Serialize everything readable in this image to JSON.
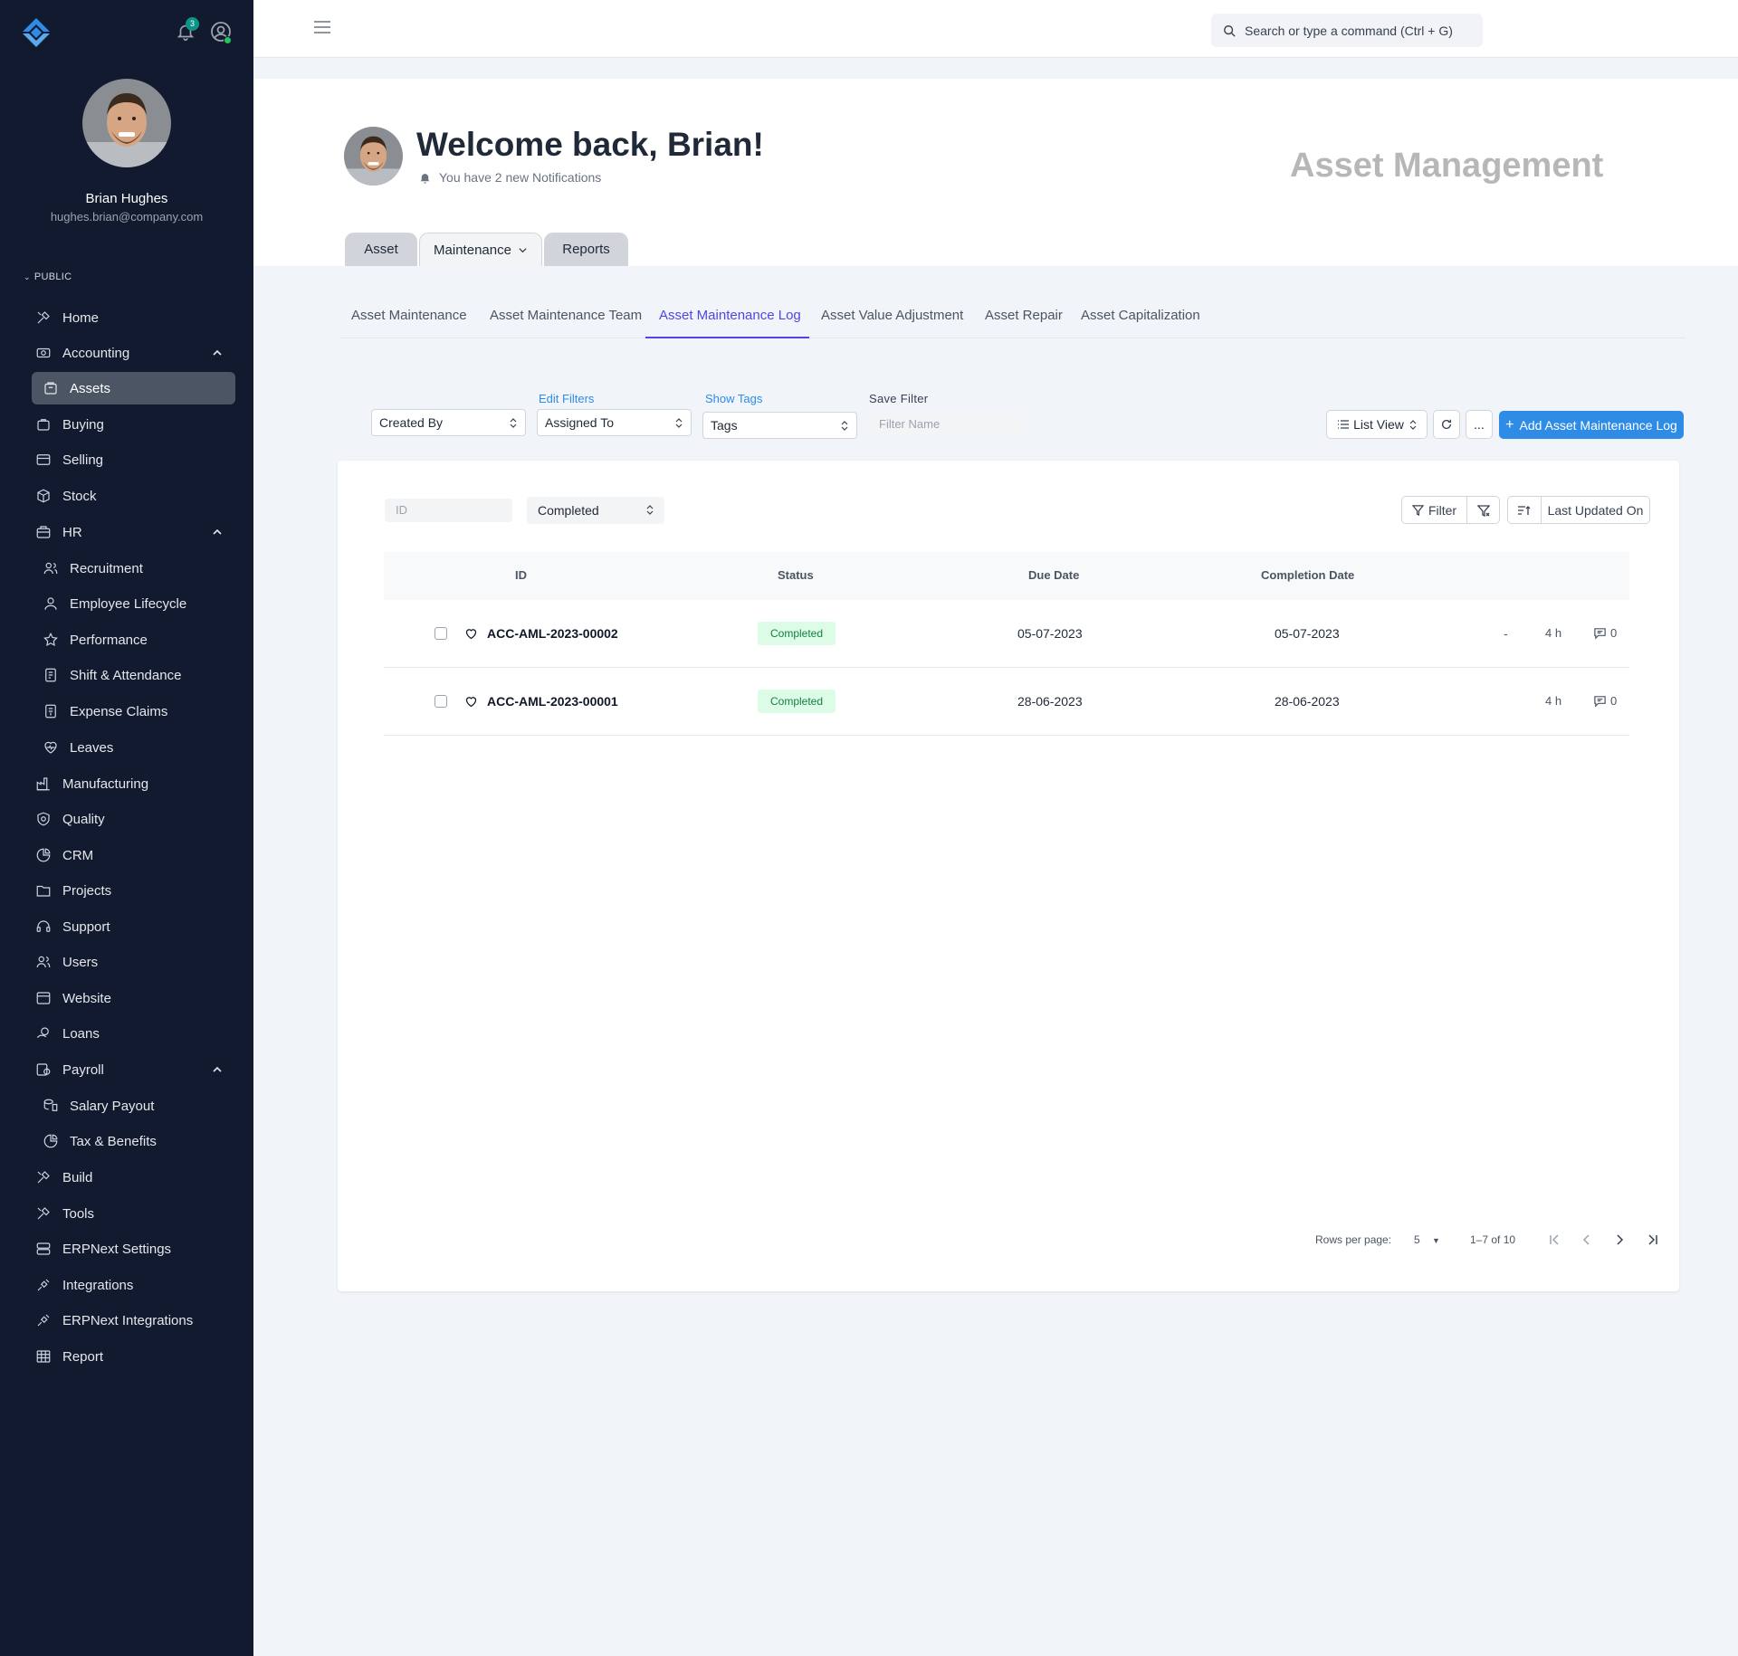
{
  "sidebar": {
    "notification_count": "3",
    "user": {
      "name": "Brian Hughes",
      "email": "hughes.brian@company.com"
    },
    "section_label": "PUBLIC",
    "items": [
      {
        "label": "Home"
      },
      {
        "label": "Accounting"
      },
      {
        "label": "Assets"
      },
      {
        "label": "Buying"
      },
      {
        "label": "Selling"
      },
      {
        "label": "Stock"
      },
      {
        "label": "HR"
      },
      {
        "label": "Recruitment"
      },
      {
        "label": "Employee Lifecycle"
      },
      {
        "label": "Performance"
      },
      {
        "label": "Shift & Attendance"
      },
      {
        "label": "Expense Claims"
      },
      {
        "label": "Leaves"
      },
      {
        "label": "Manufacturing"
      },
      {
        "label": "Quality"
      },
      {
        "label": "CRM"
      },
      {
        "label": "Projects"
      },
      {
        "label": "Support"
      },
      {
        "label": "Users"
      },
      {
        "label": "Website"
      },
      {
        "label": "Loans"
      },
      {
        "label": "Payroll"
      },
      {
        "label": "Salary Payout"
      },
      {
        "label": "Tax & Benefits"
      },
      {
        "label": "Build"
      },
      {
        "label": "Tools"
      },
      {
        "label": "ERPNext Settings"
      },
      {
        "label": "Integrations"
      },
      {
        "label": "ERPNext Integrations"
      },
      {
        "label": "Report"
      }
    ]
  },
  "topbar": {
    "search_placeholder": "Search or type a command (Ctrl + G)"
  },
  "header": {
    "welcome": "Welcome back, Brian!",
    "notifications": "You have 2 new Notifications",
    "app_title": "Asset Management",
    "tabs": [
      {
        "label": "Asset"
      },
      {
        "label": "Maintenance"
      },
      {
        "label": "Reports"
      }
    ]
  },
  "subtabs": [
    {
      "label": "Asset Maintenance"
    },
    {
      "label": "Asset Maintenance Team"
    },
    {
      "label": "Asset Maintenance Log"
    },
    {
      "label": "Asset Value Adjustment"
    },
    {
      "label": "Asset Repair"
    },
    {
      "label": "Asset Capitalization"
    }
  ],
  "filters": {
    "created_by": "Created By",
    "edit_filters": "Edit Filters",
    "assigned_to": "Assigned To",
    "show_tags": "Show Tags",
    "tags": "Tags",
    "save_filter": "Save Filter",
    "filter_name_placeholder": "Filter Name",
    "list_view": "List View",
    "more": "...",
    "add_button": "Add Asset Maintenance Log"
  },
  "list": {
    "id_placeholder": "ID",
    "status_value": "Completed",
    "filter_label": "Filter",
    "sort_label": "Last Updated On",
    "columns": {
      "id": "ID",
      "status": "Status",
      "due_date": "Due Date",
      "completion_date": "Completion Date"
    },
    "rows": [
      {
        "id": "ACC-AML-2023-00002",
        "status": "Completed",
        "due_date": "05-07-2023",
        "completion_date": "05-07-2023",
        "dash": "-",
        "time": "4 h",
        "comments": "0"
      },
      {
        "id": "ACC-AML-2023-00001",
        "status": "Completed",
        "due_date": "28-06-2023",
        "completion_date": "28-06-2023",
        "dash": "",
        "time": "4 h",
        "comments": "0"
      }
    ],
    "pagination": {
      "rows_per_page_label": "Rows per page:",
      "rows_per_page": "5",
      "range": "1–7 of 10"
    }
  },
  "colors": {
    "sidebar_bg": "#111a2e",
    "accent": "#2e8ce6",
    "active_tab": "#4f46e5",
    "badge_bg": "#dcfce7",
    "badge_text": "#15803d"
  }
}
